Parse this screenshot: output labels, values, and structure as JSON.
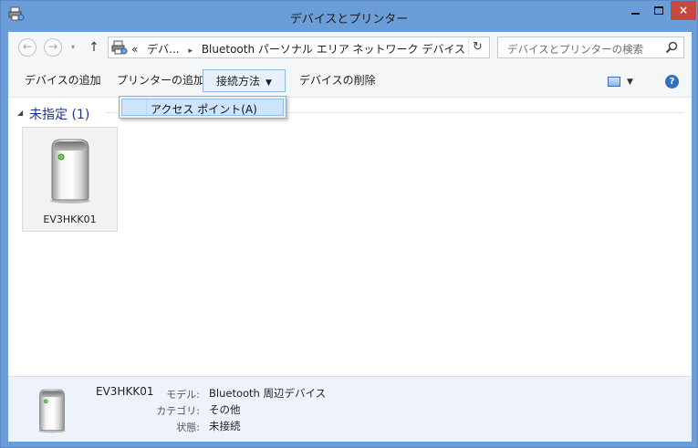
{
  "window": {
    "title": "デバイスとプリンター",
    "minimize_icon": "minimize-icon",
    "maximize_icon": "maximize-icon",
    "close_glyph": "×"
  },
  "nav": {
    "back_glyph": "←",
    "forward_glyph": "→",
    "history_glyph": "▾",
    "up_glyph": "↑",
    "refresh_glyph": "↻",
    "address_prefix": "«",
    "breadcrumbs": [
      "デバ...",
      "Bluetooth パーソナル エリア ネットワーク デバイス"
    ],
    "breadcrumb_separator": "▸",
    "dropdown_glyph": "⌄",
    "search_placeholder": "デバイスとプリンターの検索"
  },
  "toolbar": {
    "add_device": "デバイスの追加",
    "add_printer": "プリンターの追加",
    "connect_using": "接続方法",
    "connect_caret": "▼",
    "remove_device": "デバイスの削除",
    "view_caret": "▼",
    "help_glyph": "?"
  },
  "menu": {
    "items": [
      {
        "label": "アクセス ポイント(A)",
        "highlighted": true
      }
    ]
  },
  "group": {
    "toggle_glyph": "◢",
    "title": "未指定 (1)"
  },
  "devices": [
    {
      "name": "EV3HKK01",
      "icon": "bluetooth-device-icon"
    }
  ],
  "details": {
    "name": "EV3HKK01",
    "fields": [
      {
        "key": "モデル:",
        "value": "Bluetooth 周辺デバイス"
      },
      {
        "key": "カテゴリ:",
        "value": "その他"
      },
      {
        "key": "状態:",
        "value": "未接続"
      }
    ]
  },
  "colors": {
    "title_bar": "#6b9ed9",
    "close_button": "#c7483f",
    "group_header": "#1e3287",
    "menu_highlight": "#cde4fa",
    "details_background": "#eef3fb"
  }
}
